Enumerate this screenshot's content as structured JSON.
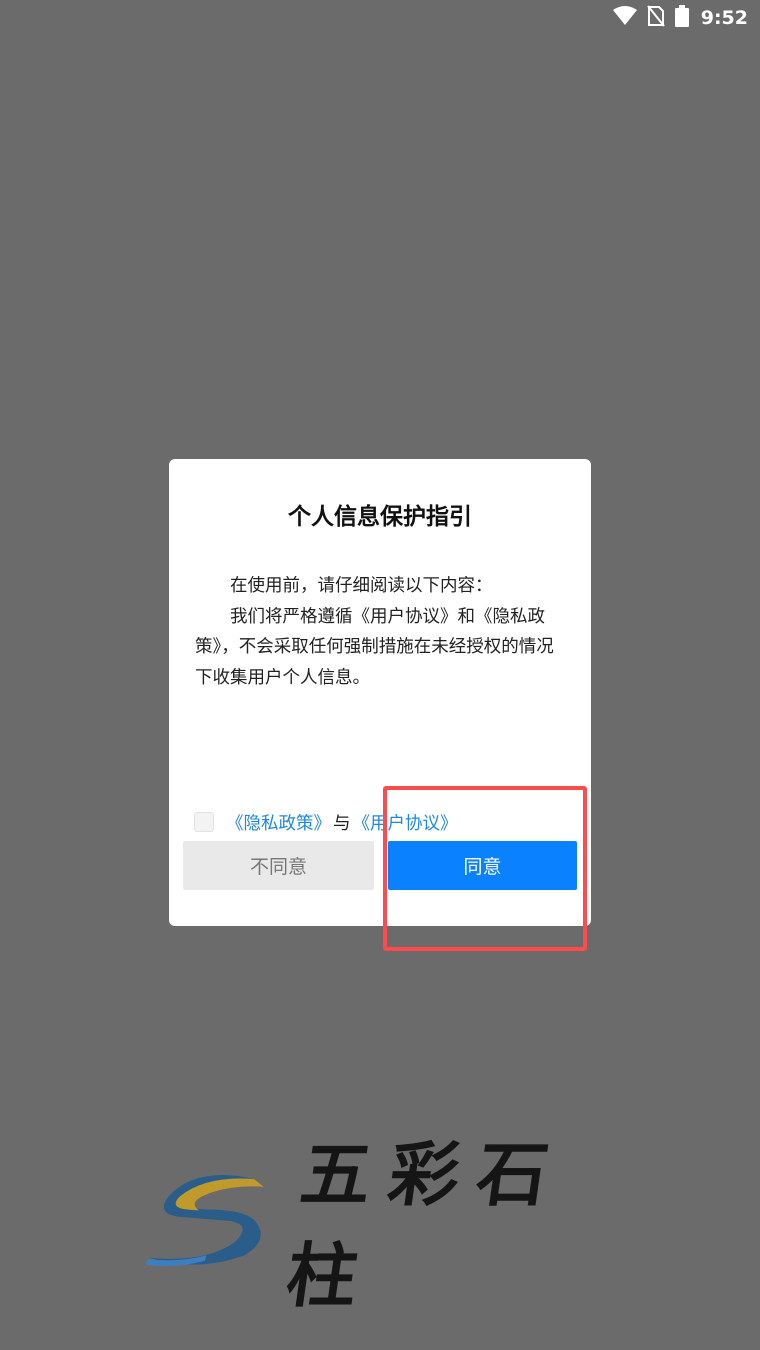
{
  "status_bar": {
    "time": "9:52",
    "icons": [
      "wifi-icon",
      "no-sim-icon",
      "battery-icon"
    ]
  },
  "dialog": {
    "title": "个人信息保护指引",
    "paragraphs": [
      "在使用前，请仔细阅读以下内容：",
      "我们将严格遵循《用户协议》和《隐私政策》，不会采取任何强制措施在未经授权的情况下收集用户个人信息。"
    ],
    "privacy_link": "《隐私政策》",
    "conjunction": "与",
    "user_agreement_link": "《用户协议》",
    "disagree_label": "不同意",
    "agree_label": "同意"
  },
  "logo": {
    "text": "五彩石柱"
  },
  "colors": {
    "overlay": "#6b6b6b",
    "accent": "#0a82ff",
    "link": "#1e88e5",
    "highlight": "#ff4b4b"
  }
}
